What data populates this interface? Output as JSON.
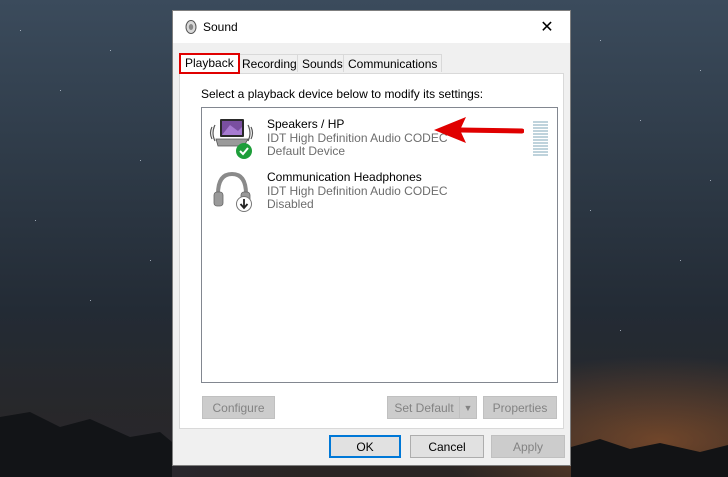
{
  "window": {
    "title": "Sound",
    "close_glyph": "✕"
  },
  "tabs": [
    {
      "label": "Playback",
      "active": true
    },
    {
      "label": "Recording",
      "active": false
    },
    {
      "label": "Sounds",
      "active": false
    },
    {
      "label": "Communications",
      "active": false
    }
  ],
  "playback": {
    "instructions": "Select a playback device below to modify its settings:",
    "devices": [
      {
        "name": "Speakers / HP",
        "description": "IDT High Definition Audio CODEC",
        "status": "Default Device",
        "icon": "speaker-icon",
        "badge": "checkmark-badge-icon"
      },
      {
        "name": "Communication Headphones",
        "description": "IDT High Definition Audio CODEC",
        "status": "Disabled",
        "icon": "headphones-icon",
        "badge": "down-arrow-badge-icon"
      }
    ],
    "configure_label": "Configure",
    "set_default_label": "Set Default",
    "set_default_arrow": "▼",
    "properties_label": "Properties"
  },
  "footer": {
    "ok_label": "OK",
    "cancel_label": "Cancel",
    "apply_label": "Apply"
  },
  "colors": {
    "annotation": "#e00000",
    "check_badge": "#1e9e3a",
    "accent": "#0078d7"
  }
}
